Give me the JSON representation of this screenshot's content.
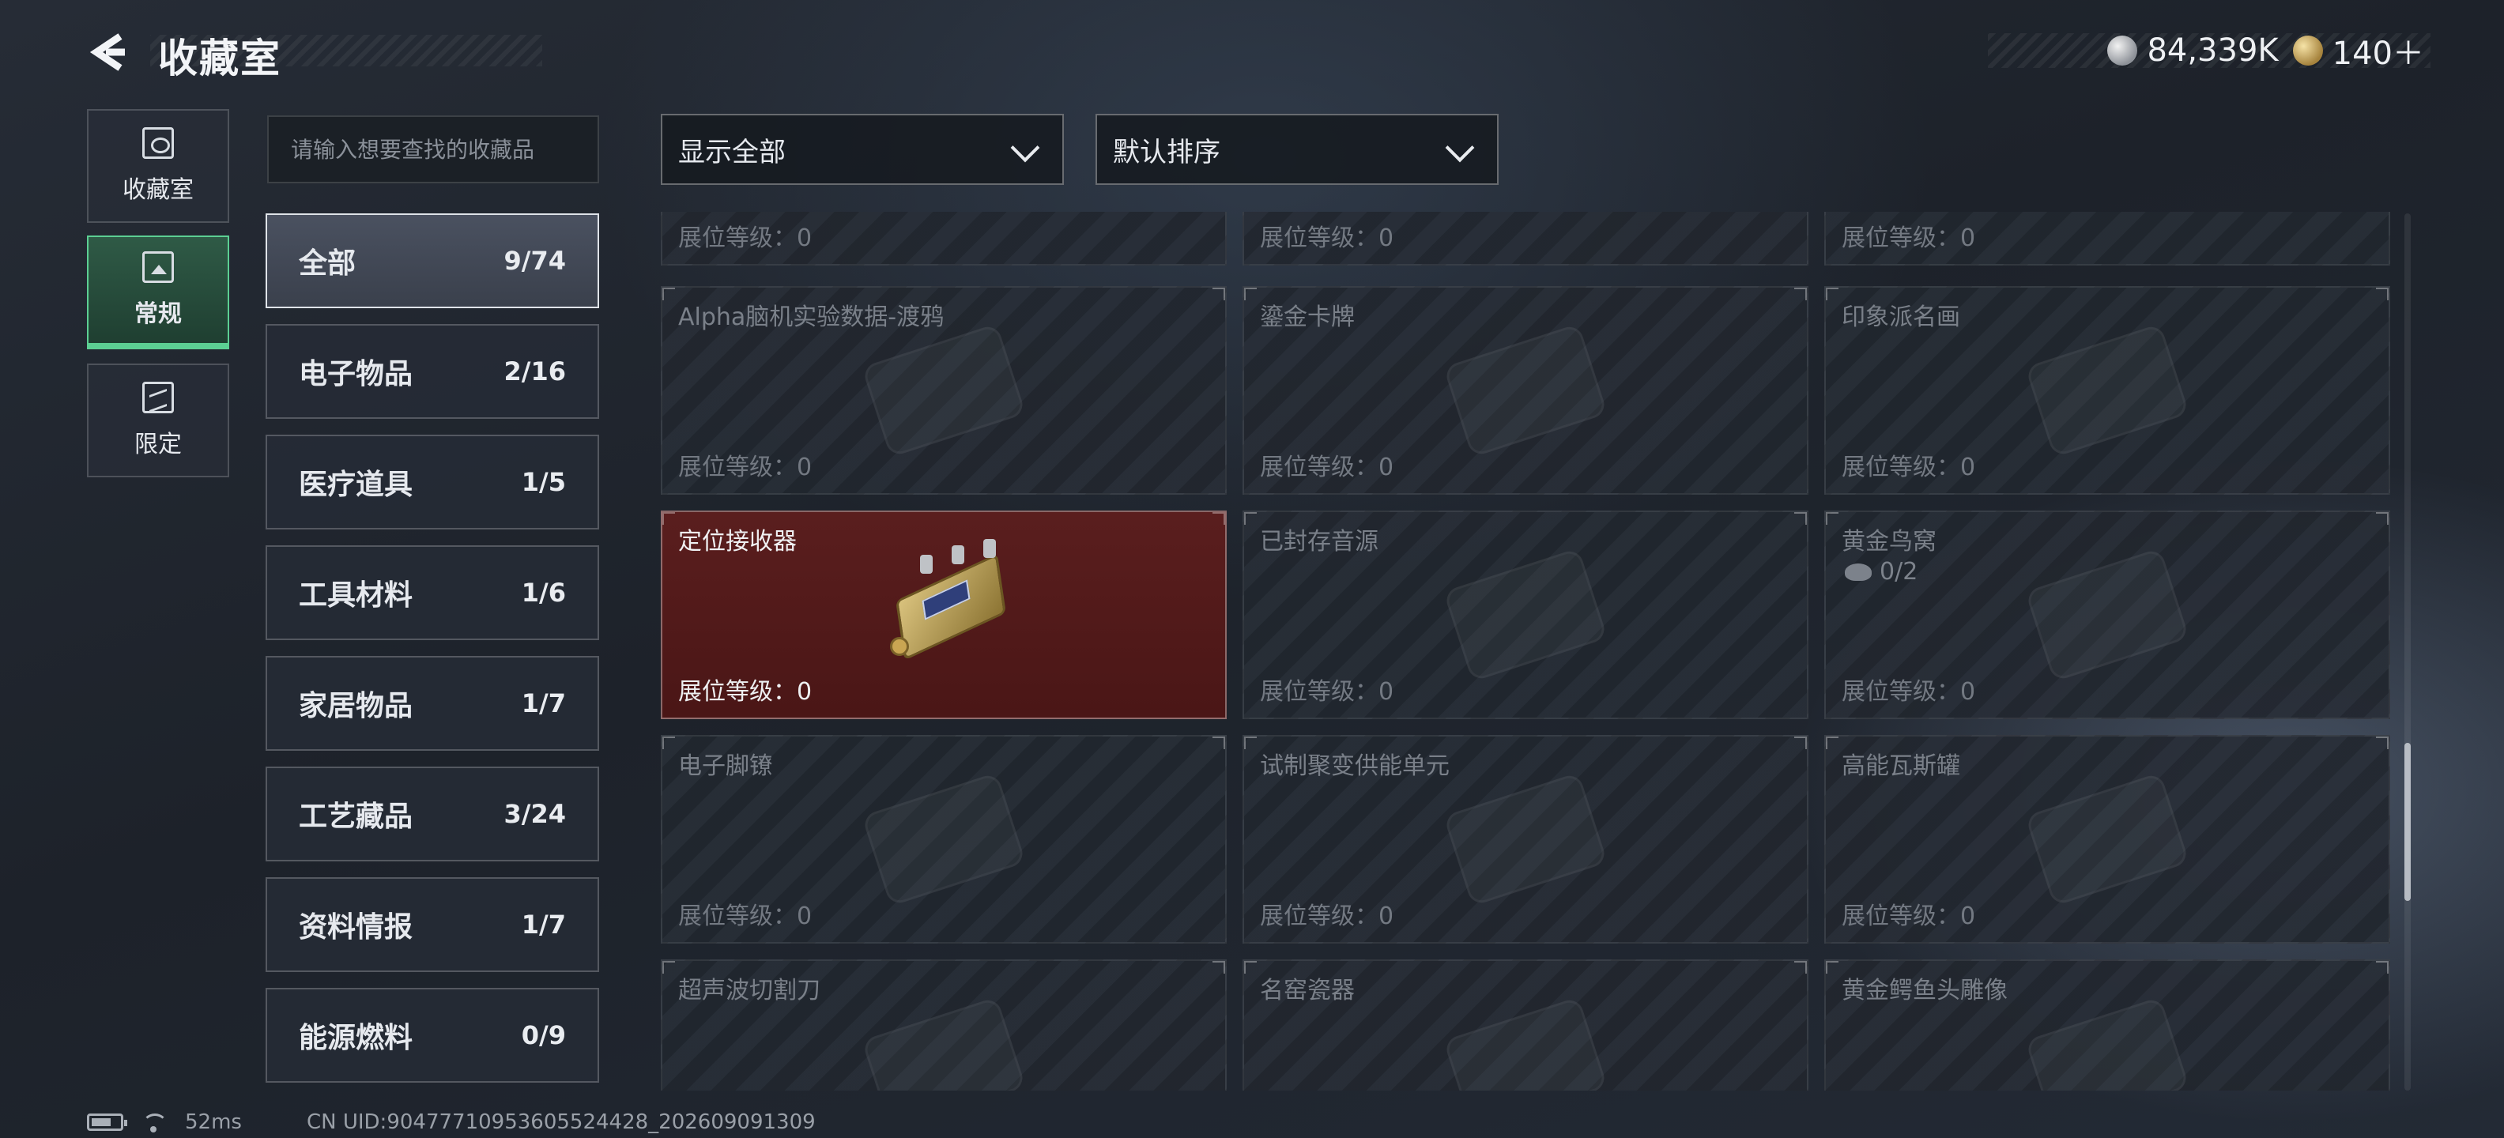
{
  "header": {
    "title": "收藏室",
    "currencies": [
      {
        "icon": "silver-coin-icon",
        "value": "84,339K"
      },
      {
        "icon": "gold-coin-icon",
        "value": "140＋"
      }
    ]
  },
  "nav": [
    {
      "label": "收藏室",
      "icon": "collection-room-icon",
      "active": false
    },
    {
      "label": "常规",
      "icon": "regular-icon",
      "active": true
    },
    {
      "label": "限定",
      "icon": "limited-icon",
      "active": false
    }
  ],
  "search": {
    "placeholder": "请输入想要查找的收藏品"
  },
  "categories": [
    {
      "label": "全部",
      "count": "9/74",
      "active": true
    },
    {
      "label": "电子物品",
      "count": "2/16"
    },
    {
      "label": "医疗道具",
      "count": "1/5"
    },
    {
      "label": "工具材料",
      "count": "1/6"
    },
    {
      "label": "家居物品",
      "count": "1/7"
    },
    {
      "label": "工艺藏品",
      "count": "3/24"
    },
    {
      "label": "资料情报",
      "count": "1/7"
    },
    {
      "label": "能源燃料",
      "count": "0/9"
    }
  ],
  "filters": {
    "display": "显示全部",
    "sort": "默认排序"
  },
  "level_label": "展位等级：",
  "items": [
    {
      "name": "",
      "level": "0",
      "owned": false
    },
    {
      "name": "",
      "level": "0",
      "owned": false
    },
    {
      "name": "",
      "level": "0",
      "owned": false
    },
    {
      "name": "Alpha脑机实验数据-渡鸦",
      "level": "0",
      "owned": false
    },
    {
      "name": "鎏金卡牌",
      "level": "0",
      "owned": false
    },
    {
      "name": "印象派名画",
      "level": "0",
      "owned": false
    },
    {
      "name": "定位接收器",
      "level": "0",
      "owned": true
    },
    {
      "name": "已封存音源",
      "level": "0",
      "owned": false
    },
    {
      "name": "黄金鸟窝",
      "level": "0",
      "owned": false,
      "sub": "0/2"
    },
    {
      "name": "电子脚镣",
      "level": "0",
      "owned": false
    },
    {
      "name": "试制聚变供能单元",
      "level": "0",
      "owned": false
    },
    {
      "name": "高能瓦斯罐",
      "level": "0",
      "owned": false
    },
    {
      "name": "超声波切割刀",
      "level": "",
      "owned": false
    },
    {
      "name": "名窑瓷器",
      "level": "",
      "owned": false
    },
    {
      "name": "黄金鳄鱼头雕像",
      "level": "",
      "owned": false
    }
  ],
  "status": {
    "ping": "52ms",
    "uid": "CN UID:90477710953605524428_202609091309"
  },
  "colors": {
    "accent_green": "#5ccf93",
    "owned_card": "#5a1e1e"
  }
}
